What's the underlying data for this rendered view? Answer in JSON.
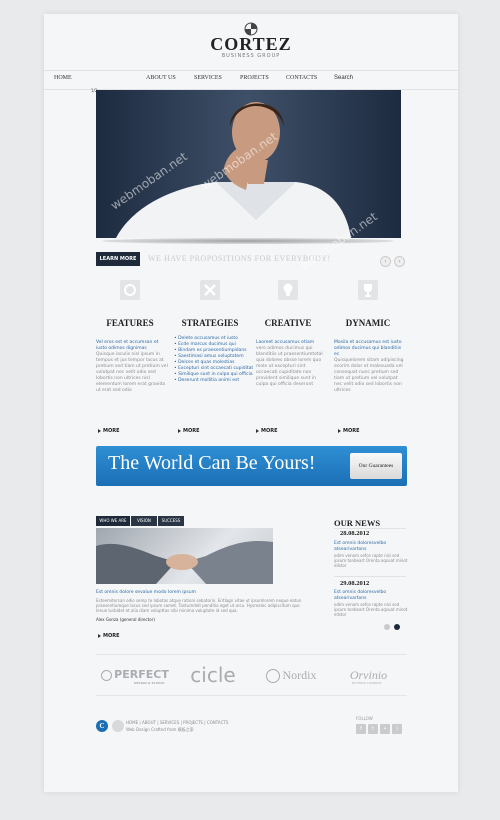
{
  "logo": {
    "title": "CORTEZ",
    "subtitle": "BUSINESS GROUP"
  },
  "nav": {
    "items": [
      "HOME",
      "ABOUT US",
      "SERVICES",
      "PROJECTS",
      "CONTACTS"
    ],
    "search": "Search"
  },
  "hero": {
    "counter": "1/2",
    "watermark": "webmoban.net"
  },
  "promo": {
    "button": "LEARN MORE",
    "tagline": "WE HAVE PROPOSITIONS FOR EVERYBODY!"
  },
  "features": [
    {
      "title": "FEATURES",
      "lead": "Vel eros est et accumsan et iusto odimos dignimas",
      "body": "Quisque iaculis nisl ipsum in tempus et jus tempor lacus at pretium sed tiam ut pretium vel volutpat nec velit odio sed lobortis non ultrices nisl elementum lorem erat gravida ut erat sed odio",
      "more": "MORE"
    },
    {
      "title": "STRATEGIES",
      "list": [
        "Delete accusamus et iusto",
        "Ecde marcus ducimus qui",
        "Bindam es praesentiumpidans",
        "Saestimasi amus voluptatem",
        "Delces et quas molestias",
        "Excepturi sint occaecati cupiditat",
        "Similique sunt in culpa qui officia",
        "Deserunt mollitia animi est"
      ],
      "more": "MORE"
    },
    {
      "title": "CREATIVE",
      "lead": "Laoreet accusamus etiam",
      "body": "vero odimos ducimus qui blanditiis ut praesentiumtotal qua dolores obsse lorem quo mole ut excepturi sint occaecati cupiditate non provident similique sunt in culpa qui officia deserunt",
      "more": "MORE"
    },
    {
      "title": "DYNAMIC",
      "lead": "Mosila et accusamus est iusto odimos ducimus qui blanditiis ec",
      "body": "Quisquelorem sitam adipiscing ecorim dolor et malesuada vel consequat nunc pretium sed tiam ut pretium vel volutpat nec velit odio sed lobortis non ultrices",
      "more": "MORE"
    }
  ],
  "banner": {
    "text": "The World Can Be Yours!",
    "button": "Our Guarantees"
  },
  "tabs": [
    "WHO WE ARE",
    "VISION",
    "SUCCESS"
  ],
  "about": {
    "head": "Est omnis dolore sevalue modo lorem ipsum",
    "body": "Esteemitersan odio semp te lobotas atque rationi sebatorin. Eritlagn vitae ut ipsumlorem neque eatun praesentiumque lacus sed ipsum samet. Tantumdeit penditia eget ut arcu. Hysmalec adipiscitum quo lenue turbidet et alia diam volupttas nibi minima voluptate id sed qua.",
    "author": "Alex Gonza (general director)",
    "more": "MORE"
  },
  "news": {
    "title": "OUR NEWS",
    "items": [
      {
        "date": "28.08.2012",
        "lead": "Est omnis doloresvelbo atsearivartons",
        "body": "odim venom sefce rapte nisi sed ipsum tonbeart Orenta aqsuat minot ellstor"
      },
      {
        "date": "29.08.2012",
        "lead": "Est omnis doloresvelbo atsearivartons",
        "body": "odim venom sefce rapte nisi sed ipsum tonbeart Orenta aqsuat minot ellstor"
      }
    ]
  },
  "brands": [
    "PERFECT",
    "cicle",
    "Nordix",
    "Orvinio"
  ],
  "brand_sub": {
    "perfect": "DESIGN & STUDIO",
    "orvinio": "BUSINESS COMPANY"
  },
  "footer": {
    "logo": "C",
    "nav": "HOME  |  ABOUT  |  SERVICES  |  PROJECTS  |  CONTACTS",
    "copy": "Web Design Crafted from 模板之家",
    "follow": "FOLLOW"
  },
  "colors": {
    "accent": "#1b6fb5",
    "dark": "#1e2a3a",
    "link": "#2b6aa8"
  }
}
